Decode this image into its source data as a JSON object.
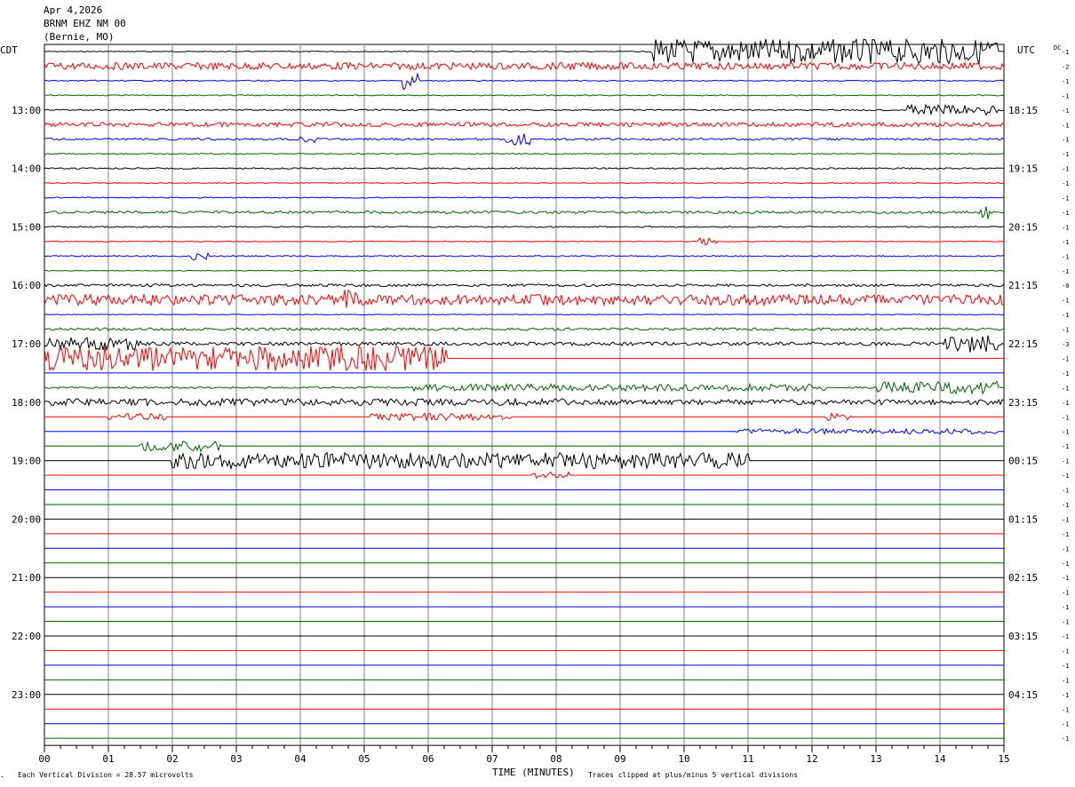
{
  "header": {
    "date": "Apr 4,2026",
    "station": "BRNM EHZ NM 00",
    "location": "(Bernie, MO)"
  },
  "left_zone": "CDT",
  "right_zone": "UTC",
  "dc_label": "DC",
  "footer": {
    "scale": "Each Vertical Division =   28.57 microvolts",
    "xlabel": "TIME (MINUTES)",
    "clip": "Traces clipped at plus/minus 5 vertical divisions"
  },
  "colors": {
    "black": "#000000",
    "red": "#ff0000",
    "blue": "#0000ff",
    "green": "#006400",
    "grid": "#808080"
  },
  "chart_data": {
    "type": "line",
    "title": "BRNM EHZ NM 00 (Bernie, MO) Apr 4,2026",
    "xlabel": "TIME (MINUTES)",
    "x_ticks": [
      "00",
      "01",
      "02",
      "03",
      "04",
      "05",
      "06",
      "07",
      "08",
      "09",
      "10",
      "11",
      "12",
      "13",
      "14",
      "15"
    ],
    "xlim": [
      0,
      15
    ],
    "left_hour_labels": [
      "13:00",
      "14:00",
      "15:00",
      "16:00",
      "17:00",
      "18:00",
      "19:00",
      "20:00",
      "21:00",
      "22:00",
      "23:00"
    ],
    "right_hour_labels": [
      "18:15",
      "19:15",
      "20:15",
      "21:15",
      "22:15",
      "23:15",
      "00:15",
      "01:15",
      "02:15",
      "03:15",
      "04:15"
    ],
    "dc_offsets": [
      "-1",
      "-2",
      "-1",
      "-1",
      "-1",
      "-1",
      "-1",
      "-1",
      "-1",
      "-1",
      "-1",
      "-1",
      "-1",
      "-1",
      "-1",
      "-1",
      "-0",
      "-1",
      "-1",
      "-1",
      "-3",
      "-1",
      "-1",
      "-1",
      "-1",
      "-1",
      "-1",
      "-1",
      "-1",
      "-1",
      "-1",
      "-1",
      "-1",
      "-1",
      "-1",
      "-1",
      "-1",
      "-1",
      "-1",
      "-1",
      "-1",
      "-1",
      "-1",
      "-1",
      "-1",
      "-1",
      "-1",
      "-1"
    ],
    "trace_colors": [
      "black",
      "red",
      "blue",
      "green"
    ],
    "trace_count": 48,
    "trace_minutes": 15,
    "noise": [
      0.5,
      4,
      0.6,
      0.6,
      0.8,
      2.5,
      1.2,
      0.6,
      0.8,
      0.5,
      0.6,
      1.5,
      0.7,
      0.4,
      0.7,
      0.4,
      1.5,
      6,
      0.4,
      1.5,
      2,
      0,
      0,
      1,
      3,
      0,
      0,
      0,
      0,
      0,
      0,
      0,
      0,
      0,
      0,
      0,
      0,
      0,
      0,
      0,
      0,
      0,
      0,
      0,
      0,
      0,
      0,
      0
    ],
    "activity": [
      {
        "trace": 0,
        "start": 9.5,
        "end": 14.9,
        "amp": 14
      },
      {
        "trace": 2,
        "start": 5.6,
        "end": 5.9,
        "amp": 10
      },
      {
        "trace": 4,
        "start": 13.5,
        "end": 14.9,
        "amp": 6
      },
      {
        "trace": 6,
        "start": 7.2,
        "end": 7.6,
        "amp": 7
      },
      {
        "trace": 6,
        "start": 4.0,
        "end": 4.3,
        "amp": 4
      },
      {
        "trace": 11,
        "start": 14.6,
        "end": 14.8,
        "amp": 8
      },
      {
        "trace": 13,
        "start": 10.2,
        "end": 10.5,
        "amp": 4
      },
      {
        "trace": 14,
        "start": 2.3,
        "end": 2.6,
        "amp": 5
      },
      {
        "trace": 17,
        "start": 4.6,
        "end": 4.9,
        "amp": 12
      },
      {
        "trace": 20,
        "start": 0,
        "end": 1.5,
        "amp": 7
      },
      {
        "trace": 20,
        "start": 14.0,
        "end": 14.9,
        "amp": 10
      },
      {
        "trace": 21,
        "start": 0,
        "end": 6.3,
        "amp": 14
      },
      {
        "trace": 23,
        "start": 5.7,
        "end": 12.2,
        "amp": 4
      },
      {
        "trace": 23,
        "start": 13.0,
        "end": 14.9,
        "amp": 7
      },
      {
        "trace": 24,
        "start": 0,
        "end": 8.5,
        "amp": 4
      },
      {
        "trace": 25,
        "start": 1.0,
        "end": 1.9,
        "amp": 4
      },
      {
        "trace": 25,
        "start": 5.1,
        "end": 7.3,
        "amp": 4
      },
      {
        "trace": 25,
        "start": 12.2,
        "end": 12.7,
        "amp": 4
      },
      {
        "trace": 26,
        "start": 10.8,
        "end": 14.9,
        "amp": 3
      },
      {
        "trace": 27,
        "start": 1.5,
        "end": 2.8,
        "amp": 6
      },
      {
        "trace": 28,
        "start": 2.0,
        "end": 11.0,
        "amp": 9
      },
      {
        "trace": 29,
        "start": 7.6,
        "end": 8.2,
        "amp": 4
      }
    ]
  }
}
